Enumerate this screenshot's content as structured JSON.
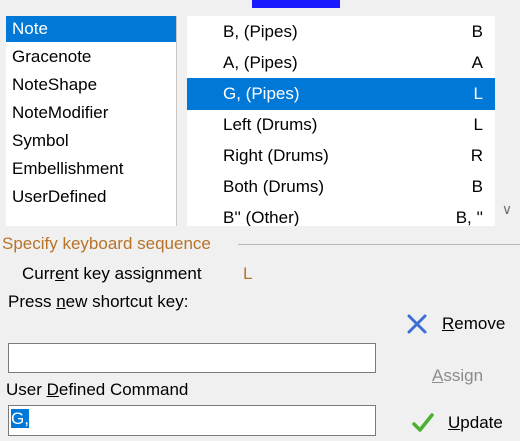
{
  "categories": [
    {
      "label": "Note",
      "selected": true
    },
    {
      "label": "Gracenote",
      "selected": false
    },
    {
      "label": "NoteShape",
      "selected": false
    },
    {
      "label": "NoteModifier",
      "selected": false
    },
    {
      "label": "Symbol",
      "selected": false
    },
    {
      "label": "Embellishment",
      "selected": false
    },
    {
      "label": "UserDefined",
      "selected": false
    }
  ],
  "commands": [
    {
      "name": "B, (Pipes)",
      "key": "B",
      "selected": false
    },
    {
      "name": "A, (Pipes)",
      "key": "A",
      "selected": false
    },
    {
      "name": "G, (Pipes)",
      "key": "L",
      "selected": true
    },
    {
      "name": "Left (Drums)",
      "key": "L",
      "selected": false
    },
    {
      "name": "Right (Drums)",
      "key": "R",
      "selected": false
    },
    {
      "name": "Both (Drums)",
      "key": "B",
      "selected": false
    },
    {
      "name": "B'' (Other)",
      "key": "B, ''",
      "selected": false
    }
  ],
  "keyboard": {
    "group_title": "Specify keyboard sequence",
    "current_label": "Current key assignment",
    "current_value": "L",
    "press_label": "Press new shortcut key:",
    "shortcut_value": ""
  },
  "user_defined": {
    "label": "User Defined Command",
    "value": "G,"
  },
  "buttons": {
    "remove": "Remove",
    "assign": "Assign",
    "update": "Update"
  },
  "colors": {
    "selection": "#0078d7",
    "group_title": "#b8732a",
    "remove_icon": "#3a6fd6",
    "update_icon": "#4caf2f"
  }
}
